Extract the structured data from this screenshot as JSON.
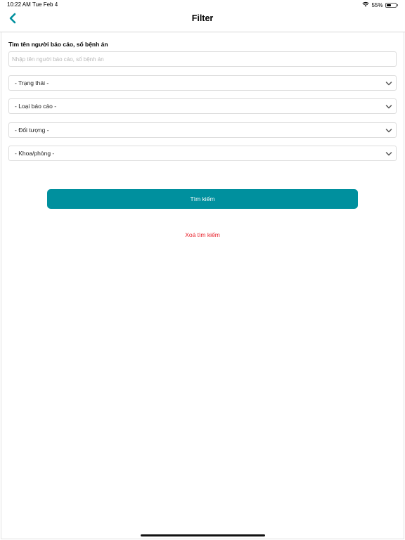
{
  "status_bar": {
    "time": "10:22 AM",
    "date": "Tue Feb 4",
    "battery_text": "55%",
    "battery_level": 0.55
  },
  "nav": {
    "title": "Filter",
    "back_icon": "chevron-left-icon",
    "accent_color": "#00909e"
  },
  "search": {
    "label": "Tìm tên người báo cáo, số bệnh án",
    "value": "",
    "placeholder": "Nhập tên người báo cáo, số bệnh án"
  },
  "filters": [
    {
      "label": "- Trạng thái -"
    },
    {
      "label": "- Loại báo cáo -"
    },
    {
      "label": "- Đối tượng -"
    },
    {
      "label": "- Khoa/phòng -"
    }
  ],
  "actions": {
    "search_label": "Tìm kiếm",
    "search_color": "#00909e",
    "clear_label": "Xoá tìm kiếm",
    "clear_color": "#e8202a"
  }
}
